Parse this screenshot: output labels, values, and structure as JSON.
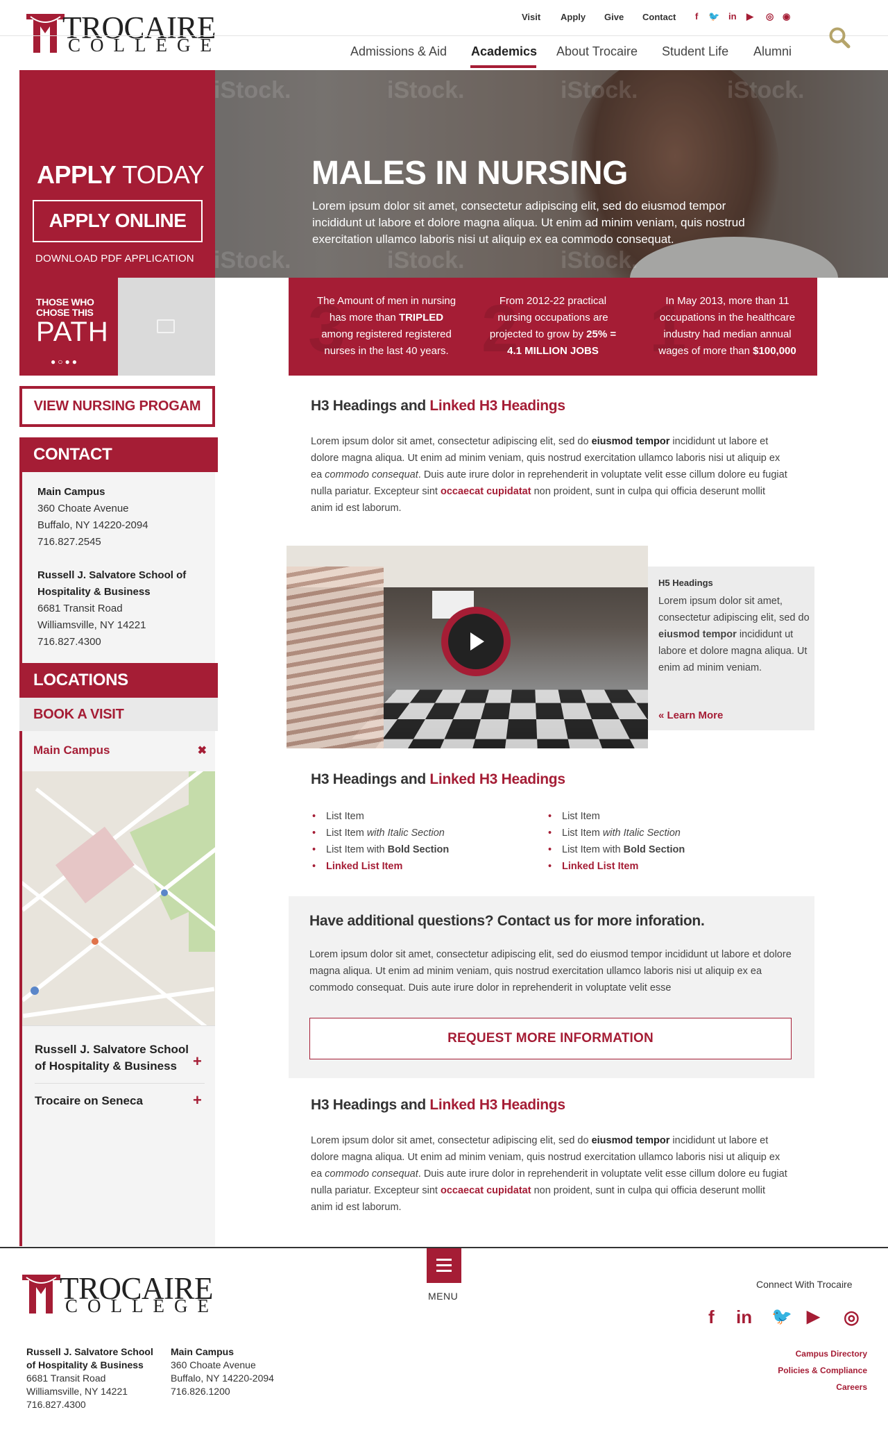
{
  "brand": {
    "name_line1": "TROCAIRE",
    "name_line2": "COLLEGE",
    "accent": "#a51d35"
  },
  "utility_nav": {
    "visit": "Visit",
    "apply": "Apply",
    "give": "Give",
    "contact": "Contact"
  },
  "social_top": [
    "f",
    "🐦",
    "in",
    "▶",
    "◎",
    "◉"
  ],
  "main_nav": [
    {
      "label": "Admissions & Aid"
    },
    {
      "label": "Academics"
    },
    {
      "label": "About Trocaire"
    },
    {
      "label": "Student Life"
    },
    {
      "label": "Alumni"
    }
  ],
  "search_icon": "search-icon",
  "hero": {
    "apply_today_bold": "APPLY",
    "apply_today_light": " TODAY",
    "apply_online": "APPLY ONLINE",
    "download_pdf": "DOWNLOAD PDF APPLICATION",
    "title": "MALES IN NURSING",
    "text": "Lorem ipsum dolor sit amet, consectetur adipiscing elit, sed do eiusmod tempor incididunt ut labore et dolore magna aliqua. Ut enim ad minim veniam, quis nostrud exercitation ullamco laboris nisi ut aliquip ex ea commodo consequat.",
    "watermark": "iStock."
  },
  "path": {
    "small": "THOSE WHO CHOSE THIS",
    "big": "PATH",
    "dots": "●○●●"
  },
  "stats": [
    {
      "num": "3",
      "pre": "The Amount of men in nursing has more than ",
      "bold": "TRIPLED",
      "post": " among registered registered nurses in the last 40 years."
    },
    {
      "num": "2",
      "pre": "From 2012-22 practical nursing occupations are projected to grow by ",
      "bold": "25% = 4.1 MILLION JOBS",
      "post": ""
    },
    {
      "num": "1",
      "pre": "In May 2013, more than 11 occupations in the healthcare industry had median annual wages of more than ",
      "bold": "$100,000",
      "post": ""
    }
  ],
  "sidebar": {
    "view_program": "VIEW NURSING PROGAM",
    "contact_head": "CONTACT",
    "main_campus": {
      "name": "Main Campus",
      "street": "360 Choate Avenue",
      "city": "Buffalo, NY 14220-2094",
      "phone": "716.827.2545"
    },
    "salvatore": {
      "name1": "Russell J. Salvatore School of",
      "name2": "Hospitality & Business",
      "street": "6681 Transit Road",
      "city": "Williamsville, NY 14221",
      "phone": "716.827.4300"
    },
    "locations_head": "LOCATIONS",
    "book_visit": "BOOK A VISIT",
    "campus_selected": "Main Campus",
    "close": "✖",
    "item1_line1": "Russell J. Salvatore School",
    "item1_line2": "of Hospitality & Business",
    "item2": "Trocaire on Seneca",
    "plus": "+"
  },
  "main": {
    "h3_plain": "H3 Headings and ",
    "h3_link": "Linked H3 Headings",
    "para": {
      "a": "Lorem ipsum dolor sit amet, consectetur adipiscing elit, sed do ",
      "b": "eiusmod tempor",
      "c": " incididunt ut labore et dolore magna aliqua. Ut enim ad minim veniam, quis nostrud exercitation ullamco laboris nisi ut aliquip ex ea ",
      "d": "commodo consequat",
      "e": ". Duis aute irure dolor in reprehenderit in voluptate velit esse cillum dolore eu fugiat nulla pariatur. Excepteur sint ",
      "f": "occaecat cupidatat",
      "g": " non proident, sunt in culpa qui officia deserunt mollit anim id est laborum."
    },
    "card": {
      "h5": "H5 Headings",
      "a": "Lorem ipsum dolor sit amet, consectetur adipiscing elit, sed do ",
      "b": "eiusmod tempor",
      "c": " incididunt ut labore et dolore magna aliqua. Ut enim ad minim veniam.",
      "learn": "« Learn More"
    },
    "list": {
      "item": "List Item",
      "with": "List Item ",
      "italic": "with Italic Section",
      "bold_pre": "List Item with ",
      "bold": "Bold Section",
      "linked": "Linked List Item"
    },
    "questions": {
      "head": "Have additional questions? Contact us for more inforation.",
      "text": "Lorem ipsum dolor sit amet, consectetur adipiscing elit, sed do eiusmod tempor incididunt ut labore et dolore magna aliqua. Ut enim ad minim veniam, quis nostrud exercitation ullamco laboris nisi ut aliquip ex ea commodo consequat. Duis aute irure dolor in reprehenderit in voluptate velit esse",
      "button": "REQUEST MORE INFORMATION"
    }
  },
  "footer": {
    "menu": "MENU",
    "connect": "Connect With Trocaire",
    "social": [
      "f",
      "in",
      "🐦",
      "▶",
      "◎"
    ],
    "links": [
      "Campus Directory",
      "Policies & Compliance",
      "Careers"
    ],
    "salvatore": {
      "name1": "Russell J. Salvatore School",
      "name2": "of Hospitality & Business",
      "street": "6681 Transit Road",
      "city": "Williamsville, NY 14221",
      "phone": "716.827.4300"
    },
    "main": {
      "name": "Main Campus",
      "street": "360 Choate Avenue",
      "city": "Buffalo, NY 14220-2094",
      "phone": "716.826.1200"
    }
  }
}
